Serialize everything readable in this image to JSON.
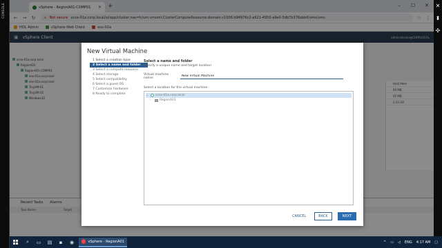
{
  "console_label": "CONSOLE",
  "browser": {
    "tab_title": "vSphere - RegionA01-COMP01",
    "new_tab": "+",
    "window_controls": [
      "–",
      "☐",
      "✕"
    ],
    "security": "Not secure",
    "url": "vcsa-01a.corp.local/ui/app/cluster;nav=h/urn:vmomi:ClusterComputeResource:domain-c1006:b94976c2-a621-4950-a9e0-5db7b376abb6/vms/vms"
  },
  "bookmarks": [
    {
      "label": "HOL Admin",
      "color": "#f0a020"
    },
    {
      "label": "vSphere Web Client",
      "color": "#4a9a4a"
    },
    {
      "label": "esx-02a",
      "color": "#d04040"
    }
  ],
  "vsphere": {
    "title": "vSphere Client",
    "user": "administrator@CORP.LOCAL"
  },
  "tree_bg": [
    "vcsa-01a.corp.local",
    "RegionA01",
    "RegionA01-COMP01",
    "esx-01a.corp.local",
    "esx-02a.corp.local",
    "TinyVM-01",
    "TinyVM-02",
    "Windows10"
  ],
  "right_panel": [
    "Host Mem",
    "90 MB",
    "92 MB",
    "2.03 GB"
  ],
  "bottom": {
    "tabs": [
      "Recent Tasks",
      "Alarms"
    ],
    "cols": [
      "Task Name",
      "Target",
      "Status",
      "Server"
    ]
  },
  "modal": {
    "title": "New Virtual Machine",
    "steps": [
      {
        "label": "1 Select a creation type",
        "state": "done"
      },
      {
        "label": "2 Select a name and folder",
        "state": "active"
      },
      {
        "label": "3 Select a compute resource",
        "state": "todo"
      },
      {
        "label": "4 Select storage",
        "state": "todo"
      },
      {
        "label": "5 Select compatibility",
        "state": "todo"
      },
      {
        "label": "6 Select a guest OS",
        "state": "todo"
      },
      {
        "label": "7 Customize hardware",
        "state": "todo"
      },
      {
        "label": "8 Ready to complete",
        "state": "todo"
      }
    ],
    "content_title": "Select a name and folder",
    "content_sub": "Specify a unique name and target location",
    "vm_name_label": "Virtual machine name:",
    "vm_name_value": "New Virtual Machine",
    "location_label": "Select a location for the virtual machine:",
    "tree": [
      {
        "label": "vcsa-01a.corp.local",
        "type": "vc",
        "indent": 0,
        "expanded": true
      },
      {
        "label": "RegionA01",
        "type": "dc",
        "indent": 1,
        "expanded": false
      }
    ],
    "buttons": {
      "cancel": "CANCEL",
      "back": "BACK",
      "next": "NEXT"
    }
  },
  "taskbar": {
    "app_label": "vSphere - RegionA01...",
    "lang": "ENG",
    "time": "4:17 AM"
  }
}
